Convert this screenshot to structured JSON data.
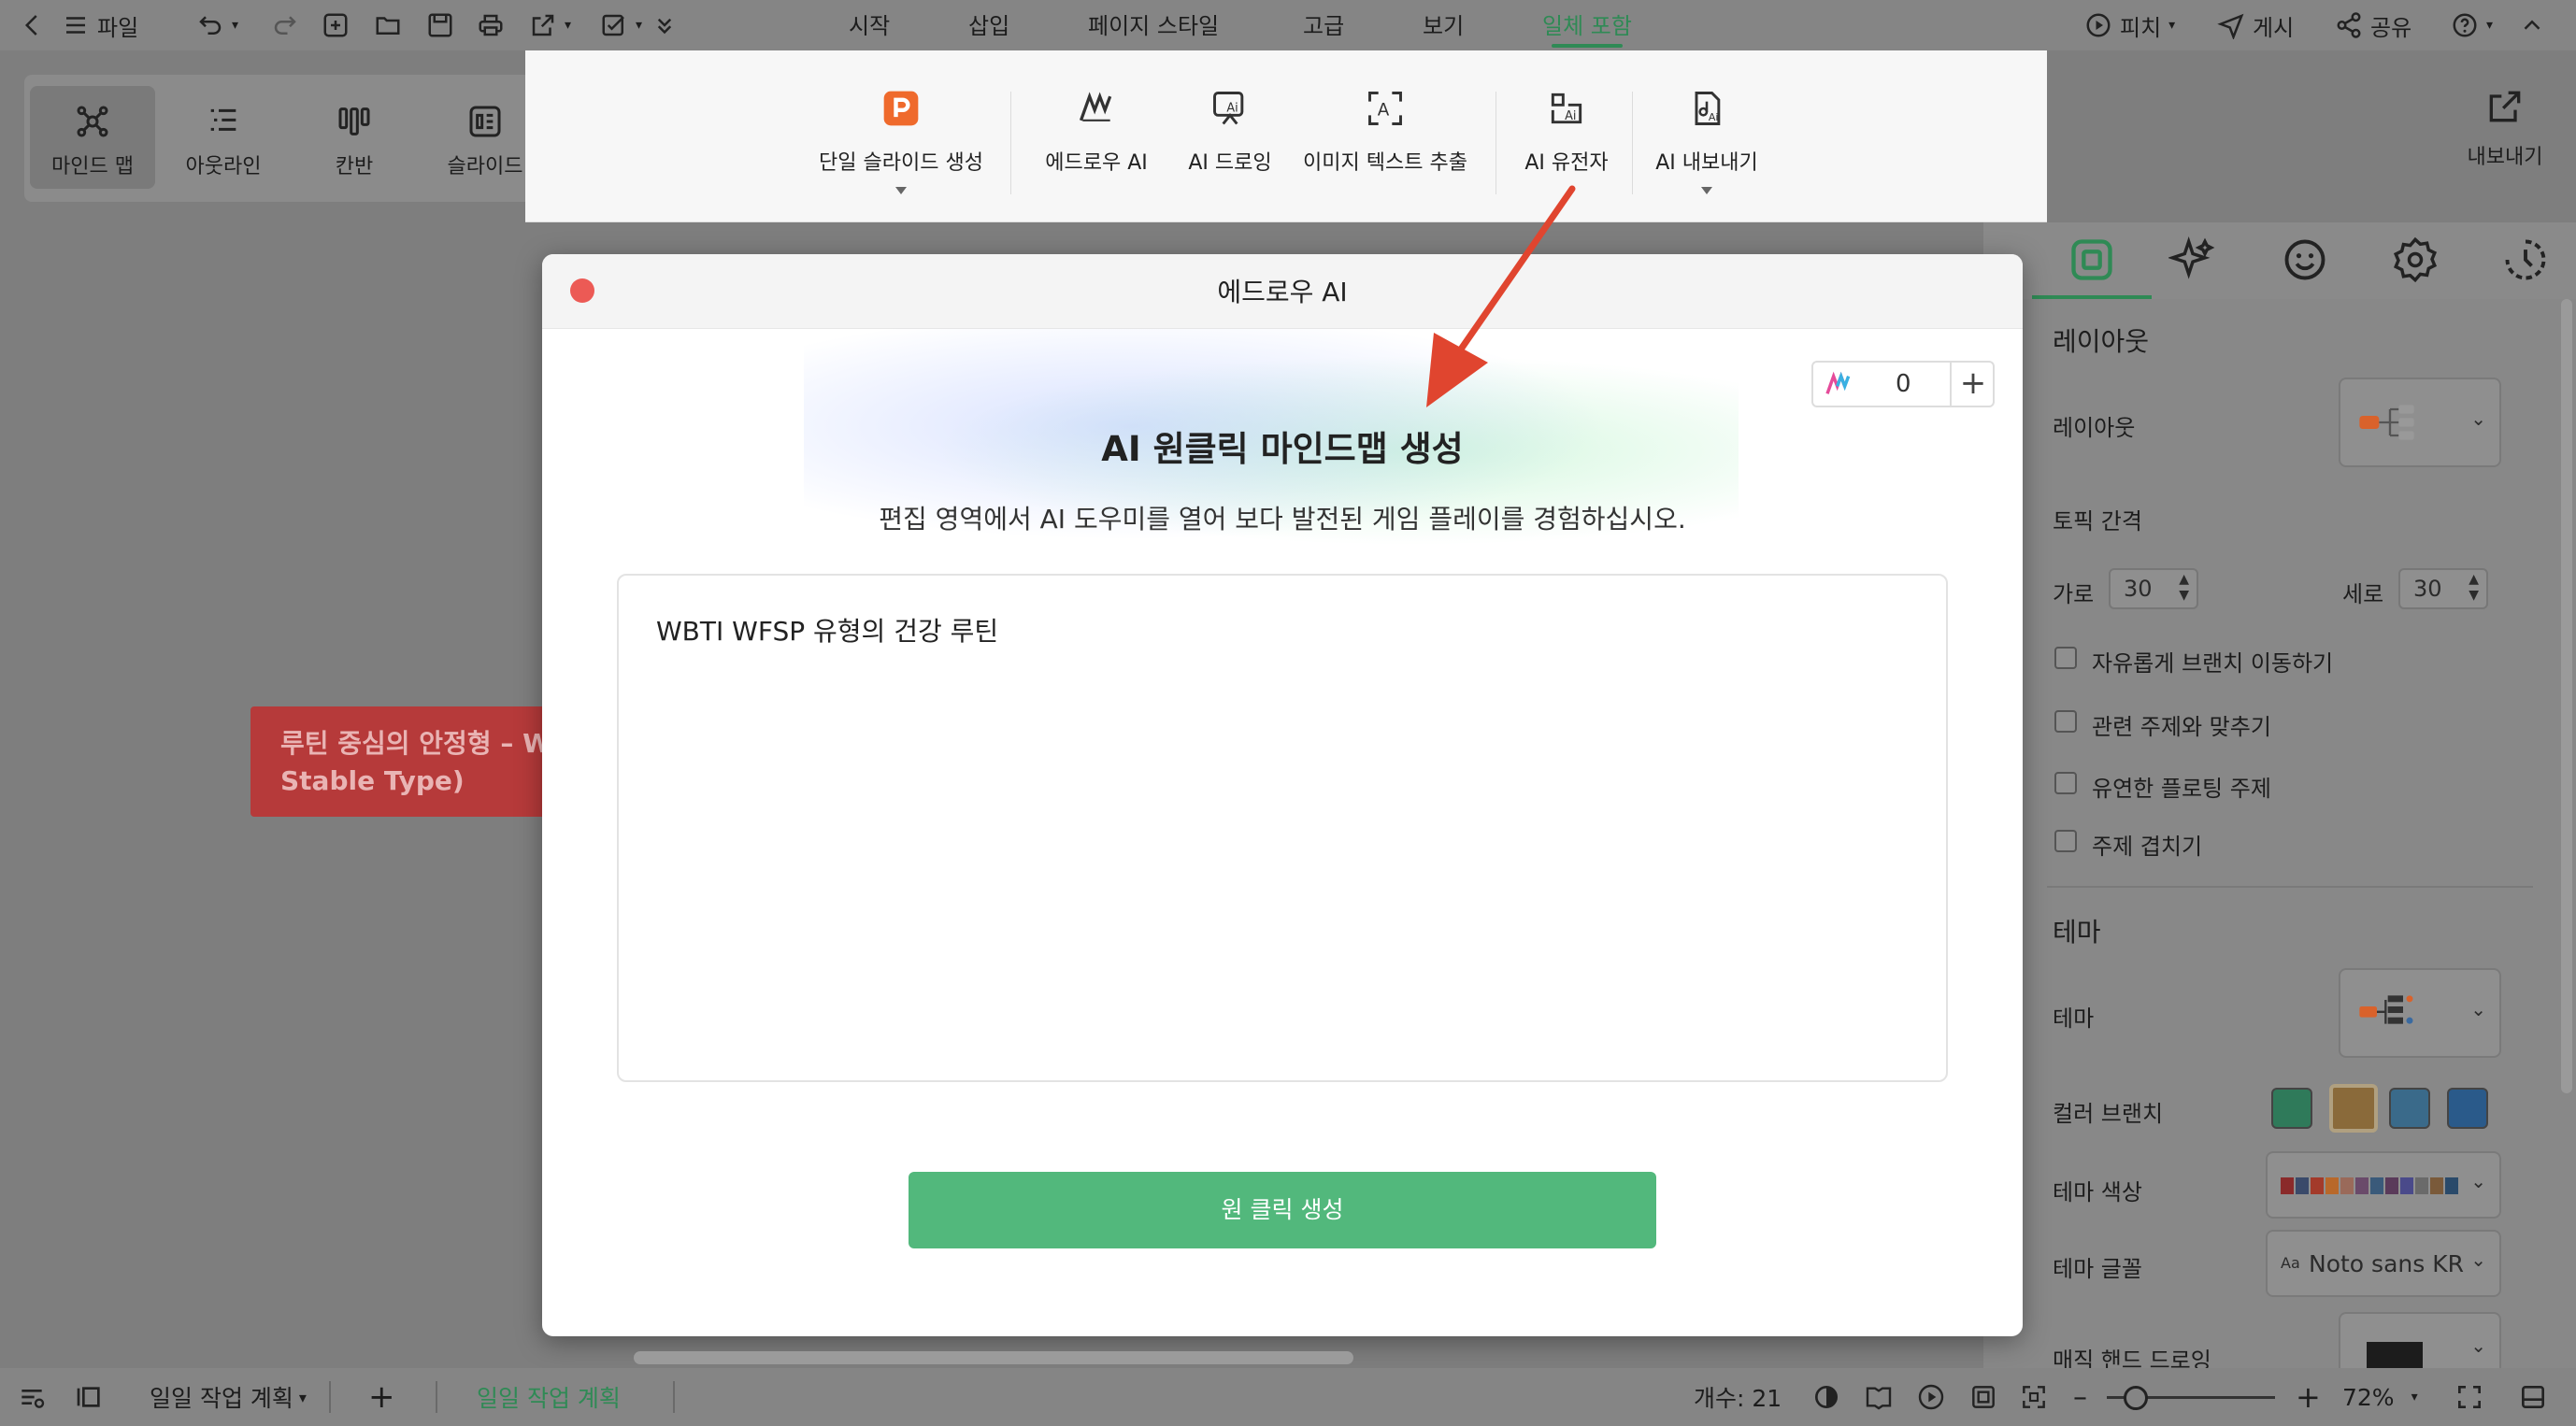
{
  "topbar": {
    "file_label": "파일",
    "tabs": [
      {
        "label": "시작"
      },
      {
        "label": "삽입"
      },
      {
        "label": "페이지 스타일"
      },
      {
        "label": "고급"
      },
      {
        "label": "보기"
      },
      {
        "label": "일체 포함",
        "active": true
      }
    ],
    "pitch_label": "피치",
    "publish_label": "게시",
    "share_label": "공유"
  },
  "views": [
    {
      "label": "마인드 맵",
      "selected": true,
      "icon": "mindmap-icon"
    },
    {
      "label": "아웃라인",
      "icon": "outline-icon"
    },
    {
      "label": "칸반",
      "icon": "kanban-icon"
    },
    {
      "label": "슬라이드",
      "icon": "slide-icon"
    }
  ],
  "ribbon": {
    "items": [
      {
        "label": "단일 슬라이드 생성",
        "icon": "ppt-icon",
        "caret": true
      },
      {
        "label": "에드로우 AI",
        "icon": "edraw-ai-icon"
      },
      {
        "label": "AI 드로잉",
        "icon": "ai-drawing-icon"
      },
      {
        "label": "이미지 텍스트 추출",
        "icon": "image-text-icon"
      },
      {
        "label": "AI 유전자",
        "icon": "ai-gene-icon"
      },
      {
        "label": "AI 내보내기",
        "icon": "ai-export-icon",
        "caret": true
      }
    ]
  },
  "export_label": "내보내기",
  "canvas": {
    "node_line1": "루틴 중심의 안정형 – W",
    "node_line2": "Stable Type)"
  },
  "dialog": {
    "title": "에드로우 AI",
    "credits": "0",
    "heading": "AI 원클릭 마인드맵 생성",
    "subtitle": "편집 영역에서 AI 도우미를 열어 보다 발전된 게임 플레이를 경험하십시오.",
    "input_value": "WBTI WFSP 유형의 건강 루틴",
    "generate_label": "원 클릭 생성"
  },
  "panel": {
    "layout_section": "레이아웃",
    "layout_label": "레이아웃",
    "topic_spacing": "토픽 간격",
    "horizontal_label": "가로",
    "horizontal_value": "30",
    "vertical_label": "세로",
    "vertical_value": "30",
    "checkboxes": [
      {
        "label": "자유롭게 브랜치 이동하기"
      },
      {
        "label": "관련 주제와 맞추기"
      },
      {
        "label": "유연한 플로팅 주제"
      },
      {
        "label": "주제 겹치기"
      }
    ],
    "theme_section": "테마",
    "theme_label": "테마",
    "color_branch_label": "컬러 브랜치",
    "theme_color_label": "테마 색상",
    "theme_font_label": "테마 글꼴",
    "theme_font_value": "Noto sans KR",
    "font_prefix": "Aa",
    "hand_drawing_label": "매직 핸드 드로잉",
    "theme_colors": [
      "#8a2a2a",
      "#3a4a6a",
      "#a33a2a",
      "#b8682a",
      "#9a6a5a",
      "#6a4a6a",
      "#3a5a7a",
      "#5a3a5a",
      "#4a4a8a",
      "#6a6a6a",
      "#7a5a3a",
      "#2a4a6a"
    ]
  },
  "bottombar": {
    "page_dropdown": "일일 작업 계획",
    "page_tab": "일일 작업 계획",
    "count": "개수: 21",
    "zoom": "72%"
  },
  "colors": {
    "accent": "#2f8a55",
    "generate_button": "#52b87c",
    "close_button": "#ec5a55",
    "annotation_arrow": "#e0452f",
    "node": "#b63a3a"
  }
}
